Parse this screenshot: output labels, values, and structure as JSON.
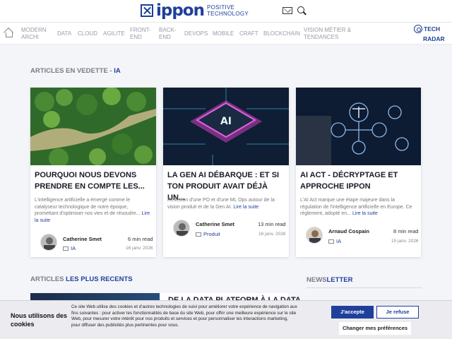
{
  "header": {
    "logo_word": "ippon",
    "logo_tag_1": "POSITIVE",
    "logo_tag_2": "TECHNOLOGY"
  },
  "nav": {
    "items": [
      {
        "line1": "MODERN",
        "line2": "ARCHI"
      },
      {
        "line1": "DATA",
        "line2": ""
      },
      {
        "line1": "CLOUD",
        "line2": ""
      },
      {
        "line1": "AGILITE",
        "line2": ""
      },
      {
        "line1": "FRONT-",
        "line2": "END"
      },
      {
        "line1": "BACK-",
        "line2": "END"
      },
      {
        "line1": "DEVOPS",
        "line2": ""
      },
      {
        "line1": "MOBILE",
        "line2": ""
      },
      {
        "line1": "CRAFT",
        "line2": ""
      },
      {
        "line1": "BLOCKCHAIN",
        "line2": ""
      },
      {
        "line1": "VISION MÉTIER &",
        "line2": "TENDANCES"
      }
    ],
    "radar_1": "TECH",
    "radar_2": "RADAR"
  },
  "featured": {
    "title_prefix": "ARTICLES EN VEDETTE - ",
    "title_highlight": "IA",
    "cards": [
      {
        "title": "POURQUOI NOUS DEVONS PRENDRE EN COMPTE LES...",
        "excerpt": "L'intelligence artificielle a émergé comme le catalyseur technologique de notre époque, promettant d'optimiser nos vies et de résoudre... ",
        "more": "Lire la suite",
        "author": "Catherine Smet",
        "read": "6 min read",
        "tag": "IA",
        "date": "16 janv. 2026"
      },
      {
        "title": "LA GEN AI DÉBARQUE : ET SI TON PRODUIT AVAIT DÉJÀ UN...",
        "excerpt": "Réflexion d'une PO et d'une ML Ops autour de la vision produit et de la Gen AI. ",
        "more": "Lire la suite",
        "author": "Catherine Smet",
        "read": "13 min read",
        "tag": "Produit",
        "date": "16 janv. 2026"
      },
      {
        "title": "AI ACT - DÉCRYPTAGE ET APPROCHE IPPON",
        "excerpt": "L'AI Act marque une étape majeure dans la régulation de l'intelligence artificielle en Europe. Ce règlement, adopté en... ",
        "more": "Lire la suite",
        "author": "Arnaud Cospain",
        "read": "8 min read",
        "tag": "IA",
        "date": "15 janv. 2026"
      }
    ]
  },
  "recent": {
    "title_prefix": "ARTICLES ",
    "title_highlight": "LES PLUS RECENTS",
    "card_title": "DE LA DATA PLATFORM À LA DATA"
  },
  "newsletter": {
    "part1": "NEWS",
    "part2": "LETTER"
  },
  "cookie": {
    "title": "Nous utilisons des cookies",
    "text": "Ce site Web utilise des cookies et d'autres technologies de suivi pour améliorer votre expérience de navigation aux fins suivantes : pour activer les fonctionnalités de base du site Web, pour offrir une meilleure expérience sur le site Web, pour mesurer votre intérêt pour nos produits et services et pour personnaliser les interactions marketing, pour diffuser des publicités plus pertinentes pour vous.",
    "accept": "J'accepte",
    "refuse": "Je refuse",
    "prefs": "Changer mes préférences"
  },
  "colors": {
    "brand": "#1f3f9a",
    "background": "#f4f5f9"
  }
}
